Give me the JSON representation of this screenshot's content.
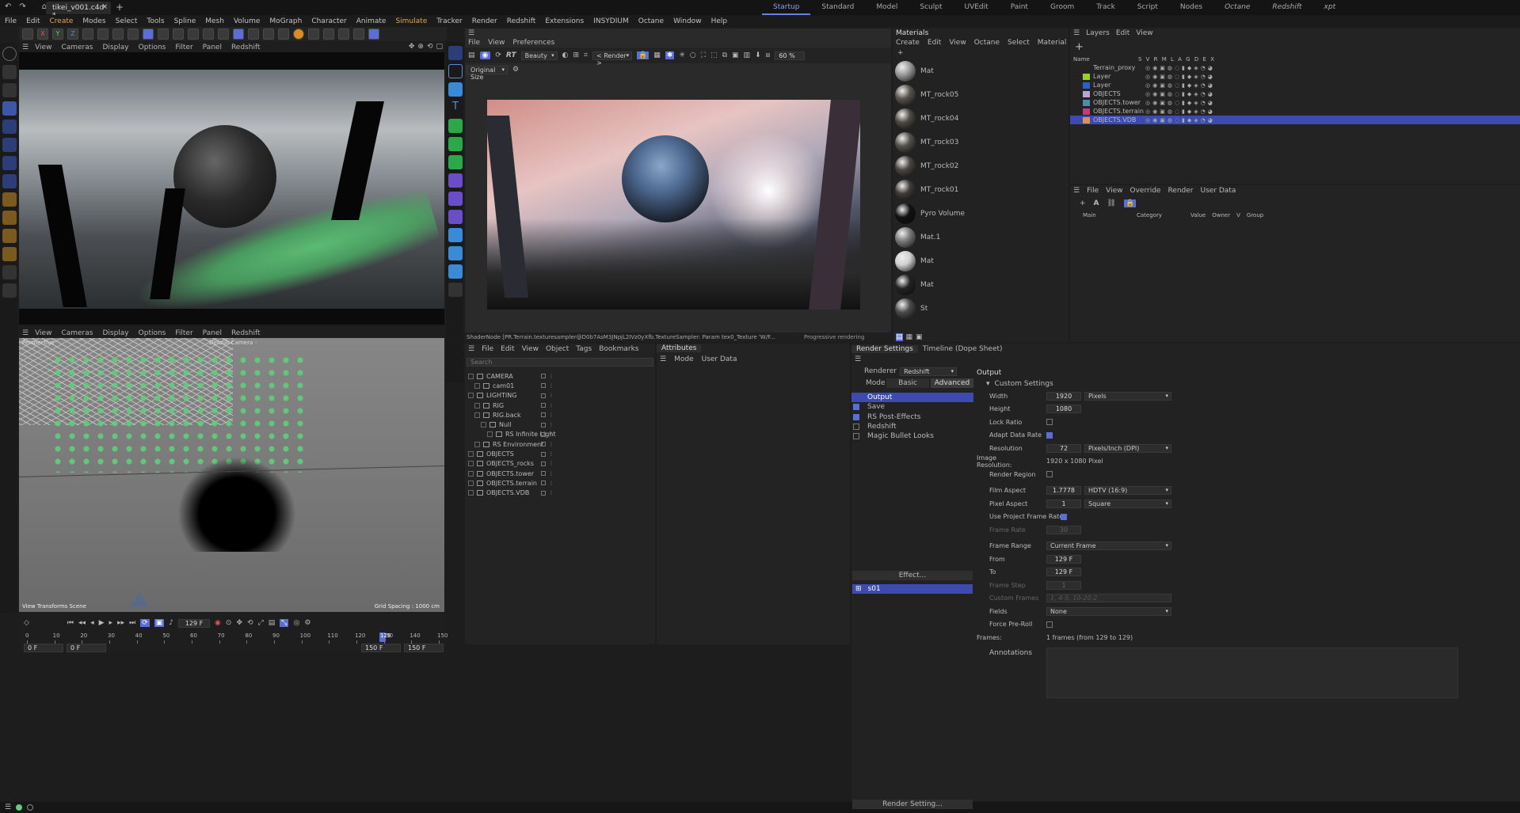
{
  "titlebar": {
    "tab_title": "tikei_v001.c4d *",
    "layouts": [
      "Startup",
      "Standard",
      "Model",
      "Sculpt",
      "UVEdit",
      "Paint",
      "Groom",
      "Track",
      "Script",
      "Nodes",
      "Octane",
      "Redshift",
      "xpt"
    ],
    "active_layout": "Startup"
  },
  "menubar": [
    "File",
    "Edit",
    "Create",
    "Modes",
    "Select",
    "Tools",
    "Spline",
    "Mesh",
    "Volume",
    "MoGraph",
    "Character",
    "Animate",
    "Simulate",
    "Tracker",
    "Render",
    "Redshift",
    "Extensions",
    "INSYDIUM",
    "Octane",
    "Window",
    "Help"
  ],
  "viewport_top": {
    "menu": [
      "View",
      "Cameras",
      "Display",
      "Options",
      "Filter",
      "Panel",
      "Redshift"
    ]
  },
  "viewport_bottom": {
    "menu": [
      "View",
      "Cameras",
      "Display",
      "Options",
      "Filter",
      "Panel",
      "Redshift"
    ],
    "label_tl": "Perspective",
    "label_tc": "Default Camera ◦",
    "footer_left": "View Transforms Scene",
    "footer_right": "Grid Spacing : 1000 cm"
  },
  "timeline": {
    "frame_field": "129 F",
    "start_left": "0 F",
    "start_left2": "0 F",
    "end_right": "150 F",
    "end_right2": "150 F",
    "ticks": [
      "0",
      "10",
      "20",
      "30",
      "40",
      "50",
      "60",
      "70",
      "80",
      "90",
      "100",
      "110",
      "120",
      "130",
      "140",
      "150"
    ],
    "current": "129"
  },
  "renderview": {
    "menu": [
      "File",
      "View",
      "Preferences"
    ],
    "rt_label": "RT",
    "beauty_select": "Beauty",
    "render_select": "< Render >",
    "zoom": "60 %",
    "size_select": "Original Size",
    "status_left": "ShaderNode [PR.Terrain.texturesampler@D0b7AsM3JNpjL2IVz0yXfb.TextureSampler: Param tex0_Texture 'W/F...",
    "status_right": "Progressive rendering"
  },
  "materials": {
    "header": "Materials",
    "menu": [
      "Create",
      "Edit",
      "View",
      "Octane",
      "Select",
      "Material",
      ">"
    ],
    "items": [
      {
        "name": "Mat",
        "color": "#9a9a9a"
      },
      {
        "name": "MT_rock05",
        "color": "#5a534c"
      },
      {
        "name": "MT_rock04",
        "color": "#4e4943"
      },
      {
        "name": "MT_rock03",
        "color": "#55504a"
      },
      {
        "name": "MT_rock02",
        "color": "#4a4540"
      },
      {
        "name": "MT_rock01",
        "color": "#3f3b37"
      },
      {
        "name": "Pyro Volume",
        "color": "#111111"
      },
      {
        "name": "Mat.1",
        "color": "#7a7a7a"
      },
      {
        "name": "Mat",
        "color": "#d0d0d0"
      },
      {
        "name": "Mat",
        "color": "#222222"
      },
      {
        "name": "St",
        "color": "#4a4a4a"
      }
    ]
  },
  "layers": {
    "menu": [
      "Layers",
      "Edit",
      "View"
    ],
    "col_name": "Name",
    "cols": "S V R M L A G D E X",
    "items": [
      {
        "name": "Terrain_proxy",
        "color": "transparent"
      },
      {
        "name": "Layer",
        "color": "#9bd11a"
      },
      {
        "name": "Layer",
        "color": "#2f5fc4"
      },
      {
        "name": "OBJECTS",
        "color": "#b7a6cf"
      },
      {
        "name": "OBJECTS.tower",
        "color": "#4b8ea8"
      },
      {
        "name": "OBJECTS.terrain",
        "color": "#c4397c"
      },
      {
        "name": "OBJECTS.VDB",
        "color": "#d8925a"
      }
    ]
  },
  "attr_panel_right": {
    "menu": [
      "File",
      "View",
      "Override",
      "Render",
      "User Data"
    ],
    "cols": [
      "Main",
      "Category",
      "Value",
      "Owner",
      "V",
      "Group"
    ]
  },
  "object_manager": {
    "menu": [
      "File",
      "Edit",
      "View",
      "Object",
      "Tags",
      "Bookmarks"
    ],
    "search_placeholder": "Search",
    "items": [
      {
        "name": "CAMERA",
        "indent": 0
      },
      {
        "name": "cam01",
        "indent": 1
      },
      {
        "name": "LIGHTING",
        "indent": 0
      },
      {
        "name": "RIG",
        "indent": 1
      },
      {
        "name": "RIG.back",
        "indent": 1
      },
      {
        "name": "Null",
        "indent": 2
      },
      {
        "name": "RS Infinite Light",
        "indent": 3
      },
      {
        "name": "RS Environment",
        "indent": 1
      },
      {
        "name": "OBJECTS",
        "indent": 0
      },
      {
        "name": "OBJECTS_rocks",
        "indent": 0
      },
      {
        "name": "OBJECTS.tower",
        "indent": 0
      },
      {
        "name": "OBJECTS.terrain",
        "indent": 0
      },
      {
        "name": "OBJECTS.VDB",
        "indent": 0
      }
    ]
  },
  "attributes": {
    "tab": "Attributes",
    "menu": [
      "Mode",
      "User Data"
    ]
  },
  "render_settings": {
    "tabs": [
      "Render Settings",
      "Timeline (Dope Sheet)"
    ],
    "renderer_label": "Renderer",
    "renderer_value": "Redshift",
    "mode_label": "Mode",
    "mode_basic": "Basic",
    "mode_advanced": "Advanced",
    "left_items": [
      {
        "name": "Output",
        "check": false,
        "selected": true
      },
      {
        "name": "Save",
        "check": true
      },
      {
        "name": "RS Post-Effects",
        "check": true
      },
      {
        "name": "Redshift",
        "check": false
      },
      {
        "name": "Magic Bullet Looks",
        "check": false
      }
    ],
    "effect_button": "Effect...",
    "preset": "s01",
    "render_setting_button": "Render Setting...",
    "output_title": "Output",
    "custom_settings": "Custom Settings",
    "width_label": "Width",
    "width_value": "1920",
    "width_unit": "Pixels",
    "height_label": "Height",
    "height_value": "1080",
    "lock_ratio": "Lock Ratio",
    "adapt_data_rate": "Adapt Data Rate",
    "resolution_label": "Resolution",
    "resolution_value": "72",
    "resolution_unit": "Pixels/Inch (DPI)",
    "image_resolution_label": "Image Resolution:",
    "image_resolution_value": "1920 x 1080 Pixel",
    "render_region": "Render Region",
    "film_aspect_label": "Film Aspect",
    "film_aspect_value": "1.7778",
    "film_aspect_preset": "HDTV (16:9)",
    "pixel_aspect_label": "Pixel Aspect",
    "pixel_aspect_value": "1",
    "pixel_aspect_preset": "Square",
    "use_project_frame_rate": "Use Project Frame Rate",
    "frame_rate_label": "Frame Rate",
    "frame_rate_value": "30",
    "frame_range_label": "Frame Range",
    "frame_range_value": "Current Frame",
    "from_label": "From",
    "from_value": "129 F",
    "to_label": "To",
    "to_value": "129 F",
    "frame_step_label": "Frame Step",
    "frame_step_value": "1",
    "custom_frames_label": "Custom Frames",
    "custom_frames_placeholder": "1, 4-5, 10-20:2",
    "fields_label": "Fields",
    "fields_value": "None",
    "force_preroll": "Force Pre-Roll",
    "frames_label": "Frames:",
    "frames_value": "1 frames (from 129 to 129)",
    "annotations_label": "Annotations"
  },
  "colors": {
    "accent": "#5b6ed8",
    "particle_green": "#5fcf7a",
    "bg": "#1d1d1d"
  }
}
